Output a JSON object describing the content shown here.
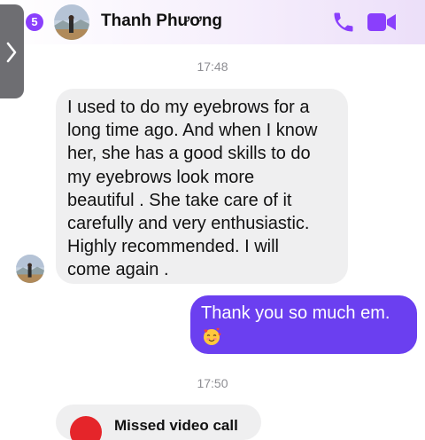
{
  "header": {
    "unread_count": "5",
    "contact_name": "Thanh Phương",
    "accent_color": "#8a3ffc"
  },
  "conversation": {
    "timestamp_1": "17:48",
    "incoming_message": "I used to do my eyebrows for a\nlong time ago. And when I know\nher, she has a good skills to do\nmy eyebrows look more\nbeautiful . She take care of it\ncarefully and very enthusiastic.\nHighly recommended. I will\ncome again .",
    "outgoing_message": "Thank you so much em.",
    "outgoing_emoji": "smiling-face-with-hearts",
    "timestamp_2": "17:50",
    "missed_call_label": "Missed video call"
  },
  "icons": [
    "back-chevron-icon",
    "phone-icon",
    "video-camera-icon",
    "side-tab-chevron-icon",
    "missed-video-call-icon"
  ],
  "colors": {
    "outgoing_bubble": "#6b3ff0",
    "incoming_bubble": "#efeff0",
    "missed_call": "#e5252a"
  }
}
